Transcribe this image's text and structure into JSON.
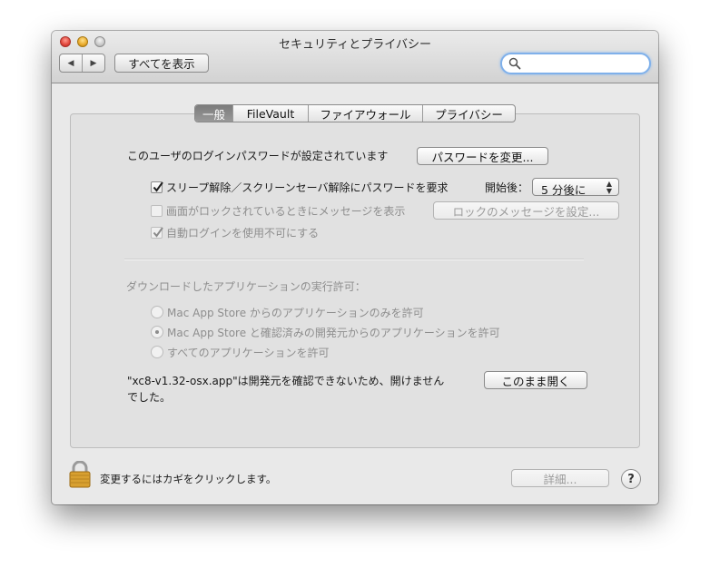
{
  "window": {
    "title": "セキュリティとプライバシー"
  },
  "toolbar": {
    "back_glyph": "◀",
    "forward_glyph": "▶",
    "show_all": "すべてを表示",
    "search_value": ""
  },
  "tabs": [
    {
      "label": "一般",
      "active": true
    },
    {
      "label": "FileVault",
      "active": false
    },
    {
      "label": "ファイアウォール",
      "active": false
    },
    {
      "label": "プライバシー",
      "active": false
    }
  ],
  "general": {
    "login_password_text": "このユーザのログインパスワードが設定されています",
    "change_password_button": "パスワードを変更...",
    "require_password_label": "スリープ解除／スクリーンセーバ解除にパスワードを要求",
    "require_password_checked": true,
    "start_after_label": "開始後：",
    "start_after_value": "5 分後に",
    "show_message_label": "画面がロックされているときにメッセージを表示",
    "show_message_checked": false,
    "set_message_button": "ロックのメッセージを設定...",
    "disable_autologin_label": "自動ログインを使用不可にする",
    "disable_autologin_checked": true
  },
  "downloads": {
    "heading": "ダウンロードしたアプリケーションの実行許可：",
    "options": [
      {
        "label": "Mac App Store からのアプリケーションのみを許可",
        "selected": false
      },
      {
        "label": "Mac App Store と確認済みの開発元からのアプリケーションを許可",
        "selected": true
      },
      {
        "label": "すべてのアプリケーションを許可",
        "selected": false
      }
    ],
    "blocked_line1": "\"xc8-v1.32-osx.app\"は開発元を確認できないため、開けません",
    "blocked_line2": "でした。",
    "open_anyway_button": "このまま開く"
  },
  "footer": {
    "lock_text": "変更するにはカギをクリックします。",
    "advanced_button": "詳細...",
    "help_glyph": "?"
  },
  "colors": {
    "checkbox_accent": "#3a7bd5",
    "search_focus": "#7fb0ea",
    "active_tab": "#8a8a8a",
    "lock_gold": "#d8a030"
  }
}
